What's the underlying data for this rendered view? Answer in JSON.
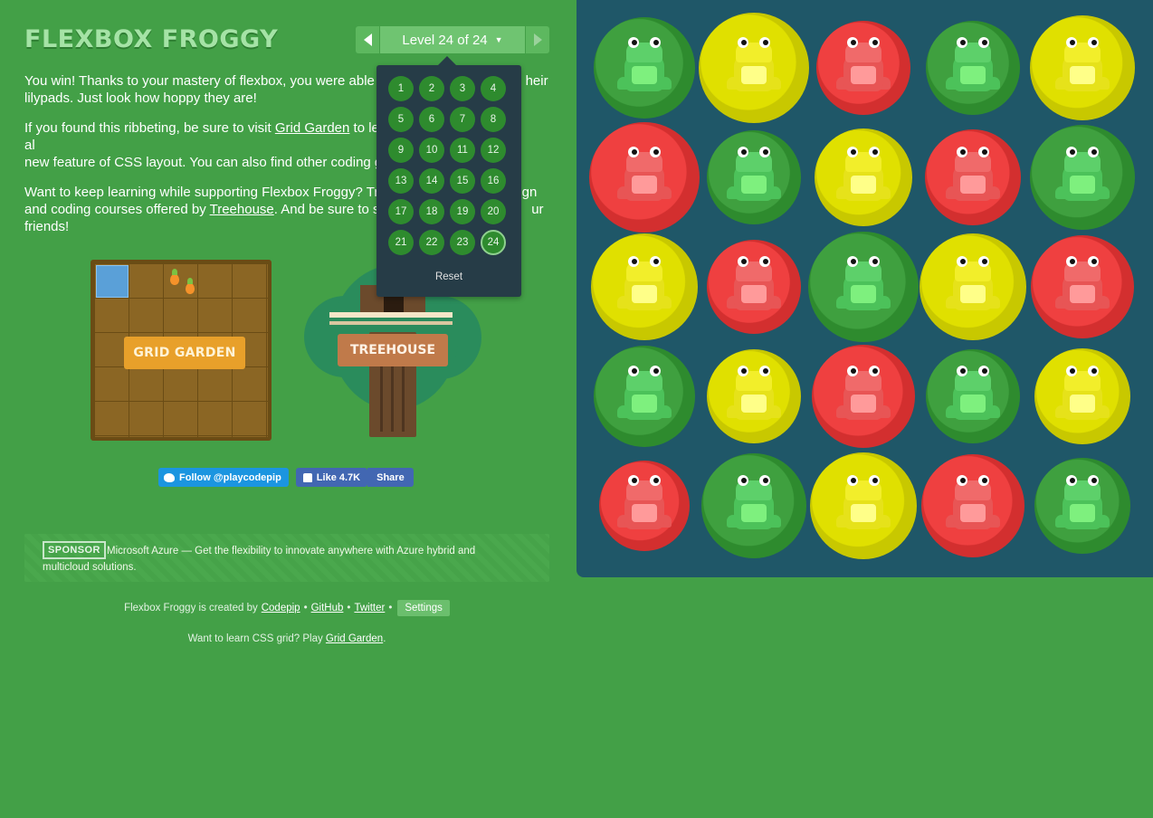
{
  "header": {
    "title": "FLEXBOX FROGGY",
    "level_label": "Level 24 of 24",
    "caret": "▼"
  },
  "intro": {
    "p1_a": "You win! Thanks to your mastery of flexbox, you were able to",
    "p1_b": "heir",
    "p1_c": "lilypads. Just look how hoppy they are!",
    "p2_a": "If you found this ribbeting, be sure to visit",
    "p2_link": "Grid Garden",
    "p2_b": "to lea",
    "p2_c": "al",
    "p2_d": "new feature of CSS layout. You can also find other coding gam",
    "p3_a": "Want to keep learning while supporting Flexbox Froggy? Try",
    "p3_b": "sign",
    "p3_c": "and coding courses offered by",
    "p3_link": "Treehouse",
    "p3_d": ". And be sure to shar",
    "p3_e": "ur",
    "p3_f": "friends!"
  },
  "promos": {
    "grid_garden": "GRID GARDEN",
    "treehouse": "TREEHOUSE"
  },
  "social": {
    "twitter": "Follow @playcodepip",
    "fb_like": "Like 4.7K",
    "fb_share": "Share"
  },
  "sponsor": {
    "badge": "SPONSOR",
    "text": "Microsoft Azure — Get the flexibility to innovate anywhere with Azure hybrid and multicloud solutions."
  },
  "footer": {
    "created_by": "Flexbox Froggy is created by",
    "codepip": "Codepip",
    "sep": "•",
    "github": "GitHub",
    "twitter": "Twitter",
    "settings": "Settings",
    "line2_a": "Want to learn CSS grid? Play",
    "line2_link": "Grid Garden",
    "line2_b": "."
  },
  "level_dropdown": {
    "levels": [
      "1",
      "2",
      "3",
      "4",
      "5",
      "6",
      "7",
      "8",
      "9",
      "10",
      "11",
      "12",
      "13",
      "14",
      "15",
      "16",
      "17",
      "18",
      "19",
      "20",
      "21",
      "22",
      "23",
      "24"
    ],
    "current": "24",
    "reset": "Reset"
  },
  "board": {
    "rows": [
      [
        "green",
        "yellow",
        "red",
        "green",
        "yellow"
      ],
      [
        "red",
        "green",
        "yellow",
        "red",
        "green"
      ],
      [
        "yellow",
        "red",
        "green",
        "yellow",
        "red"
      ],
      [
        "green",
        "yellow",
        "red",
        "green",
        "yellow"
      ],
      [
        "red",
        "green",
        "yellow",
        "red",
        "green"
      ]
    ]
  },
  "colors": {
    "background": "#43a047",
    "pond": "#1f5768",
    "green_pad": "#2e8b2e",
    "yellow_pad": "#c8c800",
    "red_pad": "#d32f2f"
  }
}
